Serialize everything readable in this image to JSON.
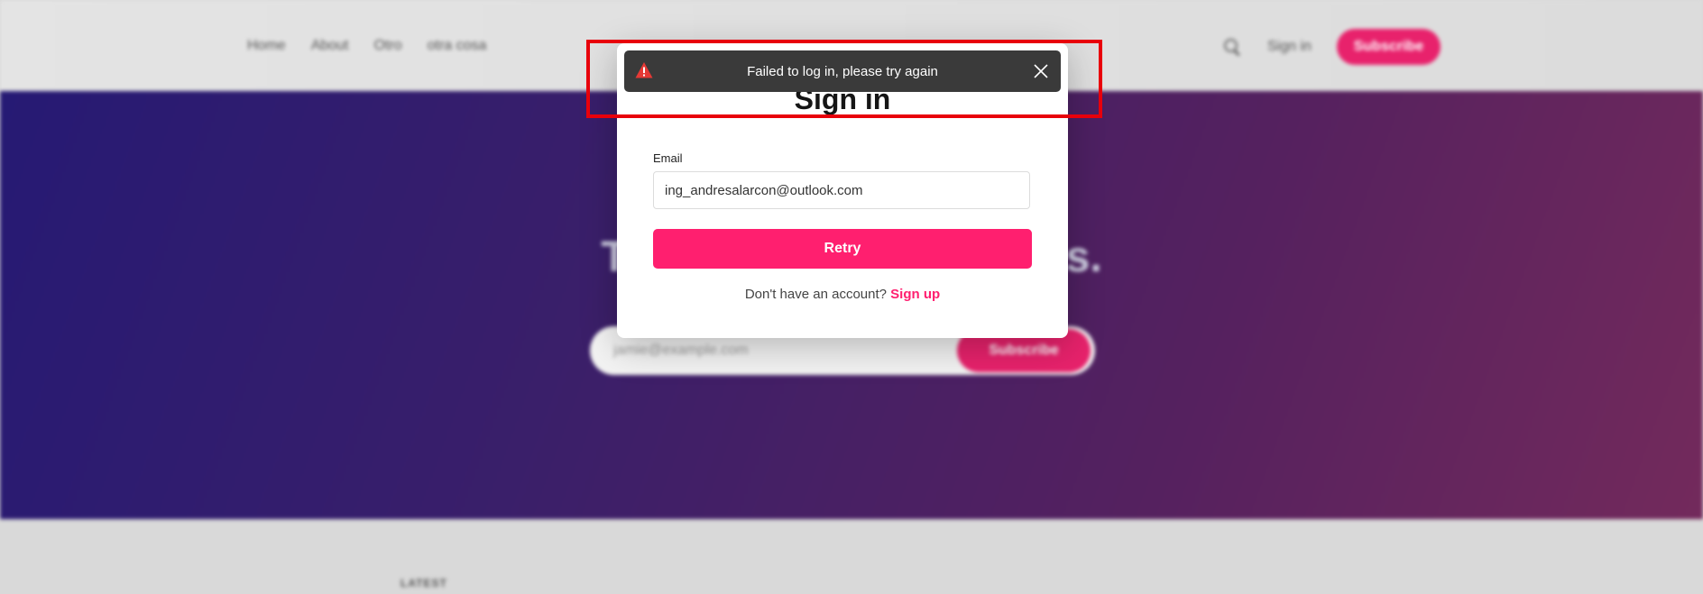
{
  "nav": {
    "items": [
      "Home",
      "About",
      "Otro",
      "otra cosa"
    ],
    "signin": "Sign in",
    "subscribe": "Subscribe"
  },
  "hero": {
    "title_left": "Th",
    "title_right": "as.",
    "email_placeholder": "jamie@example.com",
    "subscribe": "Subscribe"
  },
  "latest_label": "LATEST",
  "modal": {
    "title": "Sign in",
    "email_label": "Email",
    "email_value": "ing_andresalarcon@outlook.com",
    "retry": "Retry",
    "no_account_text": "Don't have an account? ",
    "signup": "Sign up"
  },
  "toast": {
    "message": "Failed to log in, please try again",
    "icon": "warning-icon",
    "close_icon": "close-icon"
  },
  "colors": {
    "accent": "#ff1f6f",
    "toast_bg": "#3a3a3a",
    "highlight": "#e8000b",
    "hero_start": "#261a74",
    "hero_end": "#732a5c"
  }
}
